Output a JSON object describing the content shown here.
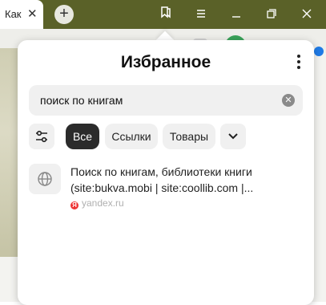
{
  "browser": {
    "tab_title": "Как",
    "tab_close": "✕",
    "new_tab": "+",
    "controls": [
      "bookmarks-icon",
      "menu-icon",
      "minimize-icon",
      "restore-icon",
      "close-icon"
    ]
  },
  "popup": {
    "title": "Избранное",
    "search": {
      "value": "поиск по книгам"
    },
    "filters": [
      {
        "label": "Все",
        "active": true
      },
      {
        "label": "Ссылки",
        "active": false
      },
      {
        "label": "Товары",
        "active": false
      }
    ],
    "results": [
      {
        "title": "Поиск по книгам, библиотеки книги (site:bukva.mobi | site:coollib.com |...",
        "source": "yandex.ru"
      }
    ]
  }
}
